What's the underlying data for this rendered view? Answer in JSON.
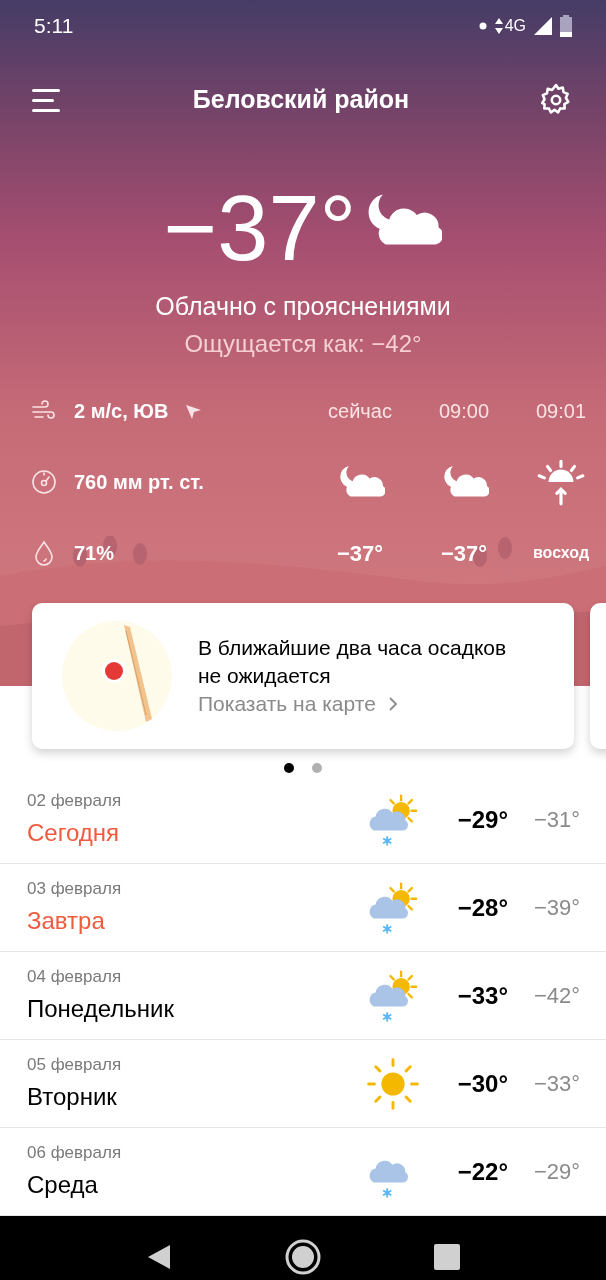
{
  "status_bar": {
    "time": "5:11",
    "network": "4G"
  },
  "header": {
    "title": "Беловский район"
  },
  "current": {
    "temperature": "−37°",
    "kind": "night-cloudy",
    "condition": "Облачно с прояснениями",
    "feels_like": "Ощущается как: −42°"
  },
  "details": [
    {
      "kind": "wind",
      "text": "2 м/с, ЮВ"
    },
    {
      "kind": "pressure",
      "text": "760 мм рт. ст."
    },
    {
      "kind": "humidity",
      "text": "71%"
    }
  ],
  "hourly": [
    {
      "time": "сейчас",
      "kind": "night-cloudy",
      "value": "−37°"
    },
    {
      "time": "09:00",
      "kind": "night-cloudy",
      "value": "−37°"
    },
    {
      "time": "09:01",
      "kind": "sunrise",
      "value": "восход"
    }
  ],
  "nowcast_card": {
    "text": "В ближайшие два часа осадков не ожидается",
    "link": "Показать на карте"
  },
  "pager": [
    {
      "selected": true
    },
    {
      "selected": false
    }
  ],
  "forecast": [
    {
      "date": "02 февраля",
      "day": "Сегодня",
      "highlight": true,
      "kind": "partly-cloudy-snow",
      "high": "−29°",
      "low": "−31°"
    },
    {
      "date": "03 февраля",
      "day": "Завтра",
      "highlight": true,
      "kind": "partly-cloudy-snow",
      "high": "−28°",
      "low": "−39°"
    },
    {
      "date": "04 февраля",
      "day": "Понедельник",
      "highlight": false,
      "kind": "partly-cloudy-snow",
      "high": "−33°",
      "low": "−42°"
    },
    {
      "date": "05 февраля",
      "day": "Вторник",
      "highlight": false,
      "kind": "sunny",
      "high": "−30°",
      "low": "−33°"
    },
    {
      "date": "06 февраля",
      "day": "Среда",
      "highlight": false,
      "kind": "cloudy-snow",
      "high": "−22°",
      "low": "−29°"
    }
  ]
}
